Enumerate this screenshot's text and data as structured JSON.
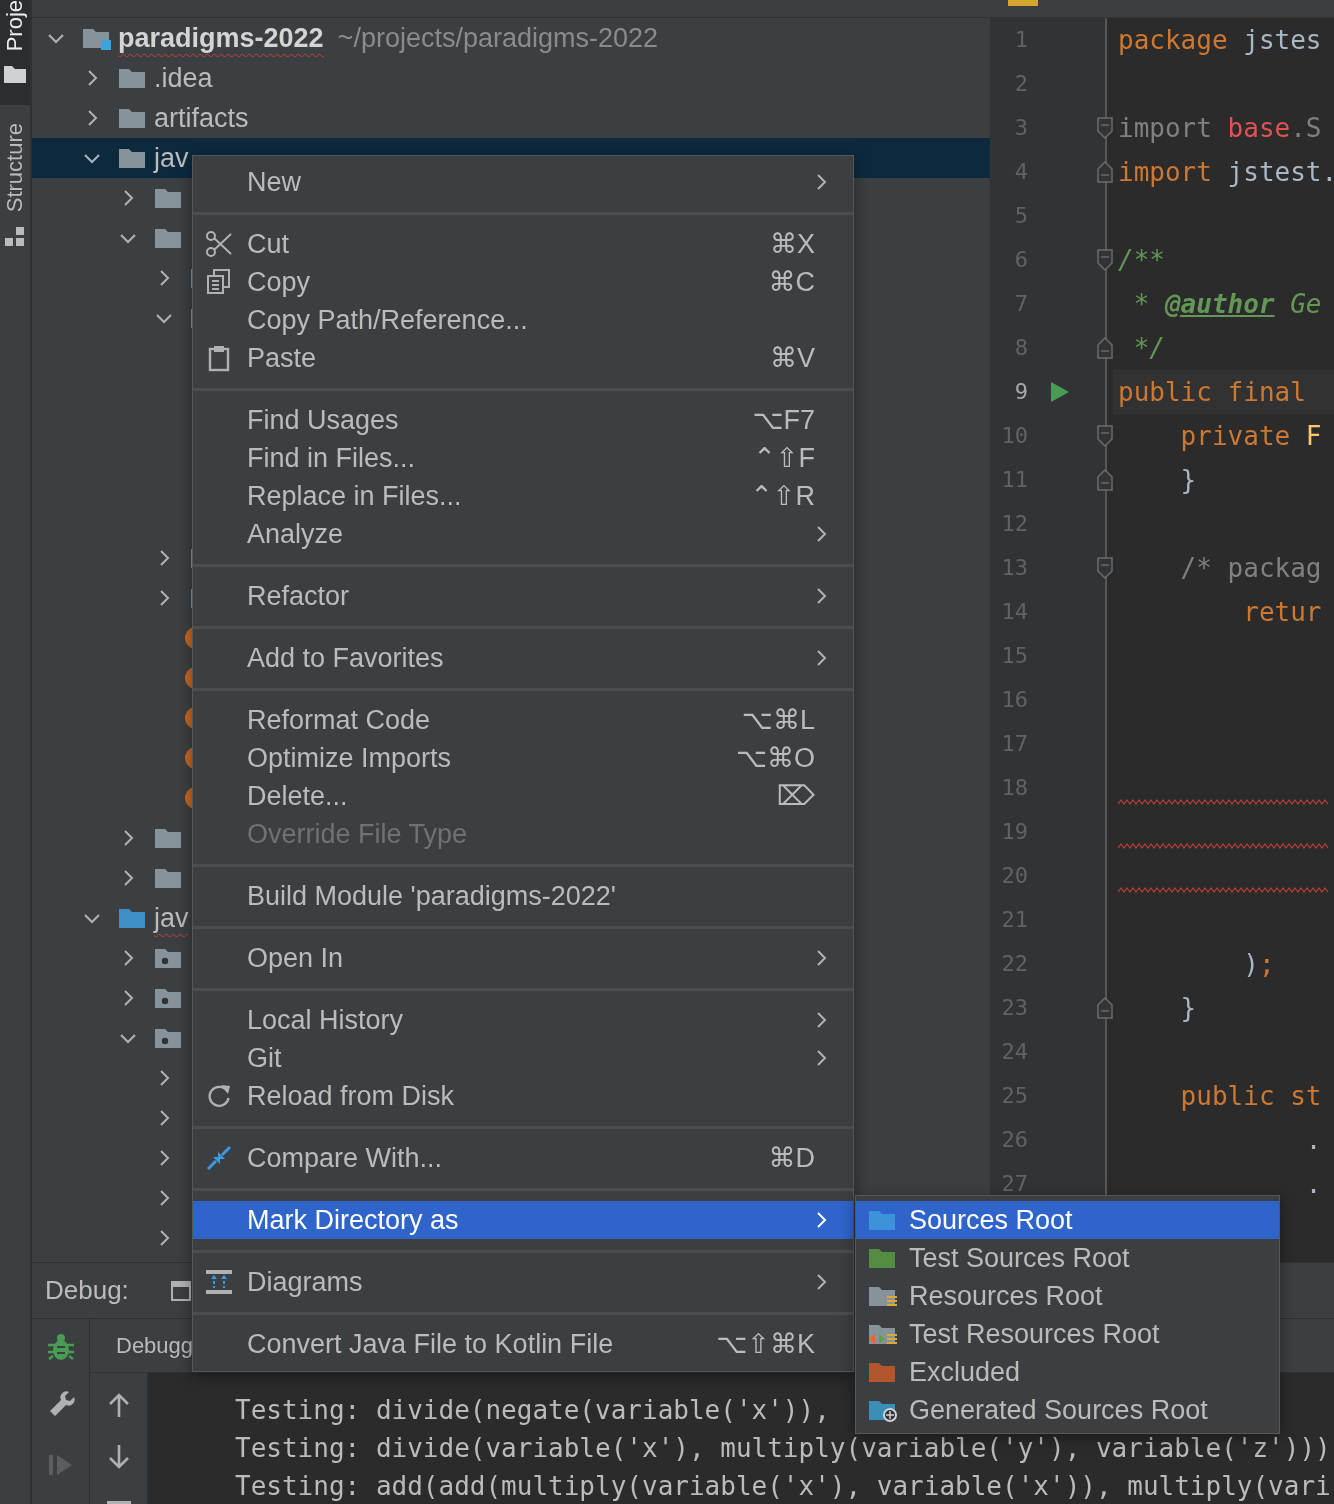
{
  "tool_strip": {
    "tabs": [
      {
        "label": "Proje",
        "selected": true
      },
      {
        "label": "Structure",
        "selected": false
      }
    ]
  },
  "project_tree": {
    "nodes": [
      {
        "kind": "module",
        "label": "paradigms-2022",
        "path": "~/projects/paradigms-2022",
        "expanded": true,
        "selected": false,
        "typo": true,
        "children": [
          {
            "kind": "folder",
            "label": ".idea",
            "expanded": false,
            "selected": false,
            "typo": false
          },
          {
            "kind": "folder",
            "label": "artifacts",
            "expanded": false,
            "selected": false,
            "typo": false
          },
          {
            "kind": "folder",
            "label": "jav",
            "expanded": true,
            "selected": true,
            "typo": false,
            "children": [
              {
                "kind": "folder",
                "expanded": false,
                "selected": false
              },
              {
                "kind": "folder",
                "expanded": true,
                "selected": false,
                "children": [
                  {
                    "kind": "folder",
                    "expanded": false,
                    "selected": false
                  },
                  {
                    "kind": "folder",
                    "expanded": true,
                    "selected": false
                  },
                  {
                    "kind": "folder",
                    "expanded": false,
                    "selected": false
                  },
                  {
                    "kind": "folder",
                    "expanded": false,
                    "selected": false
                  },
                  {
                    "kind": "class",
                    "selected": false
                  },
                  {
                    "kind": "class",
                    "selected": false
                  },
                  {
                    "kind": "class",
                    "selected": false
                  },
                  {
                    "kind": "class",
                    "selected": false
                  },
                  {
                    "kind": "class",
                    "selected": false
                  }
                ]
              },
              {
                "kind": "folder",
                "expanded": false,
                "selected": false
              },
              {
                "kind": "folder",
                "expanded": false,
                "selected": false
              }
            ]
          },
          {
            "kind": "source-root",
            "label": "jav",
            "expanded": true,
            "selected": false,
            "typo": true,
            "children": [
              {
                "kind": "package",
                "expanded": false,
                "selected": false
              },
              {
                "kind": "package",
                "expanded": false,
                "selected": false
              },
              {
                "kind": "package",
                "expanded": true,
                "selected": false,
                "children": [
                  {
                    "kind": "hidden",
                    "expanded": false,
                    "selected": false
                  },
                  {
                    "kind": "hidden",
                    "expanded": false,
                    "selected": false
                  },
                  {
                    "kind": "hidden",
                    "expanded": false,
                    "selected": false
                  },
                  {
                    "kind": "hidden",
                    "expanded": false,
                    "selected": false
                  },
                  {
                    "kind": "hidden",
                    "expanded": false,
                    "selected": false
                  }
                ]
              }
            ]
          }
        ]
      }
    ]
  },
  "editor": {
    "lines": [
      {
        "number": "1",
        "kind": "plain",
        "current": false,
        "run": false,
        "error": false,
        "tokens": [
          {
            "kind": "keyword",
            "text": "package"
          },
          {
            "kind": "plain",
            "text": " jstes"
          }
        ]
      },
      {
        "number": "2",
        "kind": "plain",
        "current": false,
        "run": false,
        "error": false
      },
      {
        "number": "3",
        "kind": "fold-start",
        "current": false,
        "run": false,
        "error": false,
        "tokens": [
          {
            "kind": "unused",
            "text": "import "
          },
          {
            "kind": "error",
            "text": "base"
          },
          {
            "kind": "unused",
            "text": ".S"
          }
        ]
      },
      {
        "number": "4",
        "kind": "fold-end",
        "current": false,
        "run": false,
        "error": false,
        "tokens": [
          {
            "kind": "keyword",
            "text": "import"
          },
          {
            "kind": "plain",
            "text": " jstest."
          }
        ]
      },
      {
        "number": "5",
        "kind": "plain",
        "current": false,
        "run": false,
        "error": false
      },
      {
        "number": "6",
        "kind": "fold-start",
        "current": false,
        "run": false,
        "error": false,
        "tokens": [
          {
            "kind": "doc",
            "text": "/**"
          }
        ]
      },
      {
        "number": "7",
        "kind": "plain",
        "current": false,
        "run": false,
        "error": false,
        "tokens": [
          {
            "kind": "doc",
            "text": " * "
          },
          {
            "kind": "doc-tag",
            "text": "@author"
          },
          {
            "kind": "doc",
            "text": " Ge"
          }
        ]
      },
      {
        "number": "8",
        "kind": "fold-end",
        "current": false,
        "run": false,
        "error": false,
        "tokens": [
          {
            "kind": "doc",
            "text": " */"
          }
        ]
      },
      {
        "number": "9",
        "kind": "plain",
        "current": true,
        "run": true,
        "error": false,
        "tokens": [
          {
            "kind": "keyword",
            "text": "public final"
          }
        ]
      },
      {
        "number": "10",
        "kind": "fold-start",
        "current": false,
        "run": false,
        "error": false,
        "tokens": [
          {
            "kind": "keyword",
            "text": "    private "
          },
          {
            "kind": "member",
            "text": "F"
          }
        ]
      },
      {
        "number": "11",
        "kind": "fold-end",
        "current": false,
        "run": false,
        "error": false,
        "tokens": [
          {
            "kind": "plain",
            "text": "    }"
          }
        ]
      },
      {
        "number": "12",
        "kind": "plain",
        "current": false,
        "run": false,
        "error": false
      },
      {
        "number": "13",
        "kind": "fold-start",
        "current": false,
        "run": false,
        "error": false,
        "tokens": [
          {
            "kind": "comment",
            "text": "    /* packag"
          }
        ]
      },
      {
        "number": "14",
        "kind": "plain",
        "current": false,
        "run": false,
        "error": false,
        "tokens": [
          {
            "kind": "keyword",
            "text": "        retur"
          }
        ]
      },
      {
        "number": "15",
        "kind": "plain",
        "current": false,
        "run": false,
        "error": false
      },
      {
        "number": "16",
        "kind": "plain",
        "current": false,
        "run": false,
        "error": false
      },
      {
        "number": "17",
        "kind": "plain",
        "current": false,
        "run": false,
        "error": false
      },
      {
        "number": "18",
        "kind": "plain",
        "current": false,
        "run": false,
        "error": true
      },
      {
        "number": "19",
        "kind": "plain",
        "current": false,
        "run": false,
        "error": true
      },
      {
        "number": "20",
        "kind": "plain",
        "current": false,
        "run": false,
        "error": true
      },
      {
        "number": "21",
        "kind": "plain",
        "current": false,
        "run": false,
        "error": false
      },
      {
        "number": "22",
        "kind": "plain",
        "current": false,
        "run": false,
        "error": false,
        "tokens": [
          {
            "kind": "plain",
            "text": "        )"
          },
          {
            "kind": "keyword",
            "text": ";"
          }
        ]
      },
      {
        "number": "23",
        "kind": "fold-end",
        "current": false,
        "run": false,
        "error": false,
        "tokens": [
          {
            "kind": "plain",
            "text": "    }"
          }
        ]
      },
      {
        "number": "24",
        "kind": "plain",
        "current": false,
        "run": false,
        "error": false
      },
      {
        "number": "25",
        "kind": "plain",
        "current": false,
        "run": false,
        "error": false,
        "tokens": [
          {
            "kind": "keyword",
            "text": "    public st"
          }
        ]
      },
      {
        "number": "26",
        "kind": "plain",
        "current": false,
        "run": false,
        "error": false,
        "tokens": [
          {
            "kind": "plain",
            "text": "            ."
          }
        ]
      },
      {
        "number": "27",
        "kind": "plain",
        "current": false,
        "run": false,
        "error": false,
        "tokens": [
          {
            "kind": "plain",
            "text": "            ."
          }
        ]
      }
    ]
  },
  "debug_panel": {
    "title": "Debug:",
    "tab": "Debugg",
    "console_lines": [
      "Testing: divide(negate(variable('x')),",
      "Testing: divide(variable('x'), multiply(variable('y'), variable('z')))",
      "Testing: add(add(multiply(variable('x'), variable('x')), multiply(vari"
    ]
  },
  "context_menu": {
    "groups": [
      {
        "items": [
          {
            "kind": "plain",
            "label": "New",
            "has_submenu": true,
            "disabled": false,
            "selected": false
          }
        ]
      },
      {
        "items": [
          {
            "kind": "cut",
            "label": "Cut",
            "shortcut": "⌘X",
            "has_submenu": false,
            "disabled": false,
            "selected": false
          },
          {
            "kind": "copy",
            "label": "Copy",
            "shortcut": "⌘C",
            "has_submenu": false,
            "disabled": false,
            "selected": false
          },
          {
            "kind": "plain",
            "label": "Copy Path/Reference...",
            "has_submenu": false,
            "disabled": false,
            "selected": false
          },
          {
            "kind": "paste",
            "label": "Paste",
            "shortcut": "⌘V",
            "has_submenu": false,
            "disabled": false,
            "selected": false
          }
        ]
      },
      {
        "items": [
          {
            "kind": "plain",
            "label": "Find Usages",
            "shortcut": "⌥F7",
            "has_submenu": false,
            "disabled": false,
            "selected": false
          },
          {
            "kind": "plain",
            "label": "Find in Files...",
            "shortcut": "⌃⇧F",
            "has_submenu": false,
            "disabled": false,
            "selected": false
          },
          {
            "kind": "plain",
            "label": "Replace in Files...",
            "shortcut": "⌃⇧R",
            "has_submenu": false,
            "disabled": false,
            "selected": false
          },
          {
            "kind": "plain",
            "label": "Analyze",
            "has_submenu": true,
            "disabled": false,
            "selected": false
          }
        ]
      },
      {
        "items": [
          {
            "kind": "plain",
            "label": "Refactor",
            "has_submenu": true,
            "disabled": false,
            "selected": false
          }
        ]
      },
      {
        "items": [
          {
            "kind": "plain",
            "label": "Add to Favorites",
            "has_submenu": true,
            "disabled": false,
            "selected": false
          }
        ]
      },
      {
        "items": [
          {
            "kind": "plain",
            "label": "Reformat Code",
            "shortcut": "⌥⌘L",
            "has_submenu": false,
            "disabled": false,
            "selected": false
          },
          {
            "kind": "plain",
            "label": "Optimize Imports",
            "shortcut": "⌥⌘O",
            "has_submenu": false,
            "disabled": false,
            "selected": false
          },
          {
            "kind": "plain",
            "label": "Delete...",
            "shortcut": "⌦",
            "has_submenu": false,
            "disabled": false,
            "selected": false
          },
          {
            "kind": "plain",
            "label": "Override File Type",
            "has_submenu": false,
            "disabled": true,
            "selected": false
          }
        ]
      },
      {
        "items": [
          {
            "kind": "plain",
            "label": "Build Module 'paradigms-2022'",
            "has_submenu": false,
            "disabled": false,
            "selected": false
          }
        ]
      },
      {
        "items": [
          {
            "kind": "plain",
            "label": "Open In",
            "has_submenu": true,
            "disabled": false,
            "selected": false
          }
        ]
      },
      {
        "items": [
          {
            "kind": "plain",
            "label": "Local History",
            "has_submenu": true,
            "disabled": false,
            "selected": false
          },
          {
            "kind": "plain",
            "label": "Git",
            "has_submenu": true,
            "disabled": false,
            "selected": false
          },
          {
            "kind": "reload",
            "label": "Reload from Disk",
            "has_submenu": false,
            "disabled": false,
            "selected": false
          }
        ]
      },
      {
        "items": [
          {
            "kind": "compare",
            "label": "Compare With...",
            "shortcut": "⌘D",
            "has_submenu": false,
            "disabled": false,
            "selected": false
          }
        ]
      },
      {
        "items": [
          {
            "kind": "plain",
            "label": "Mark Directory as",
            "has_submenu": true,
            "disabled": false,
            "selected": true,
            "submenu": {
              "items": [
                {
                  "kind": "sources",
                  "label": "Sources Root",
                  "selected": true
                },
                {
                  "kind": "test-sources",
                  "label": "Test Sources Root",
                  "selected": false
                },
                {
                  "kind": "resources",
                  "label": "Resources Root",
                  "selected": false
                },
                {
                  "kind": "test-resources",
                  "label": "Test Resources Root",
                  "selected": false
                },
                {
                  "kind": "excluded",
                  "label": "Excluded",
                  "selected": false
                },
                {
                  "kind": "generated",
                  "label": "Generated Sources Root",
                  "selected": false
                }
              ]
            }
          }
        ]
      },
      {
        "items": [
          {
            "kind": "diagram",
            "label": "Diagrams",
            "has_submenu": true,
            "disabled": false,
            "selected": false
          }
        ]
      },
      {
        "items": [
          {
            "kind": "plain",
            "label": "Convert Java File to Kotlin File",
            "shortcut": "⌥⇧⌘K",
            "has_submenu": false,
            "disabled": false,
            "selected": false
          }
        ]
      }
    ]
  }
}
